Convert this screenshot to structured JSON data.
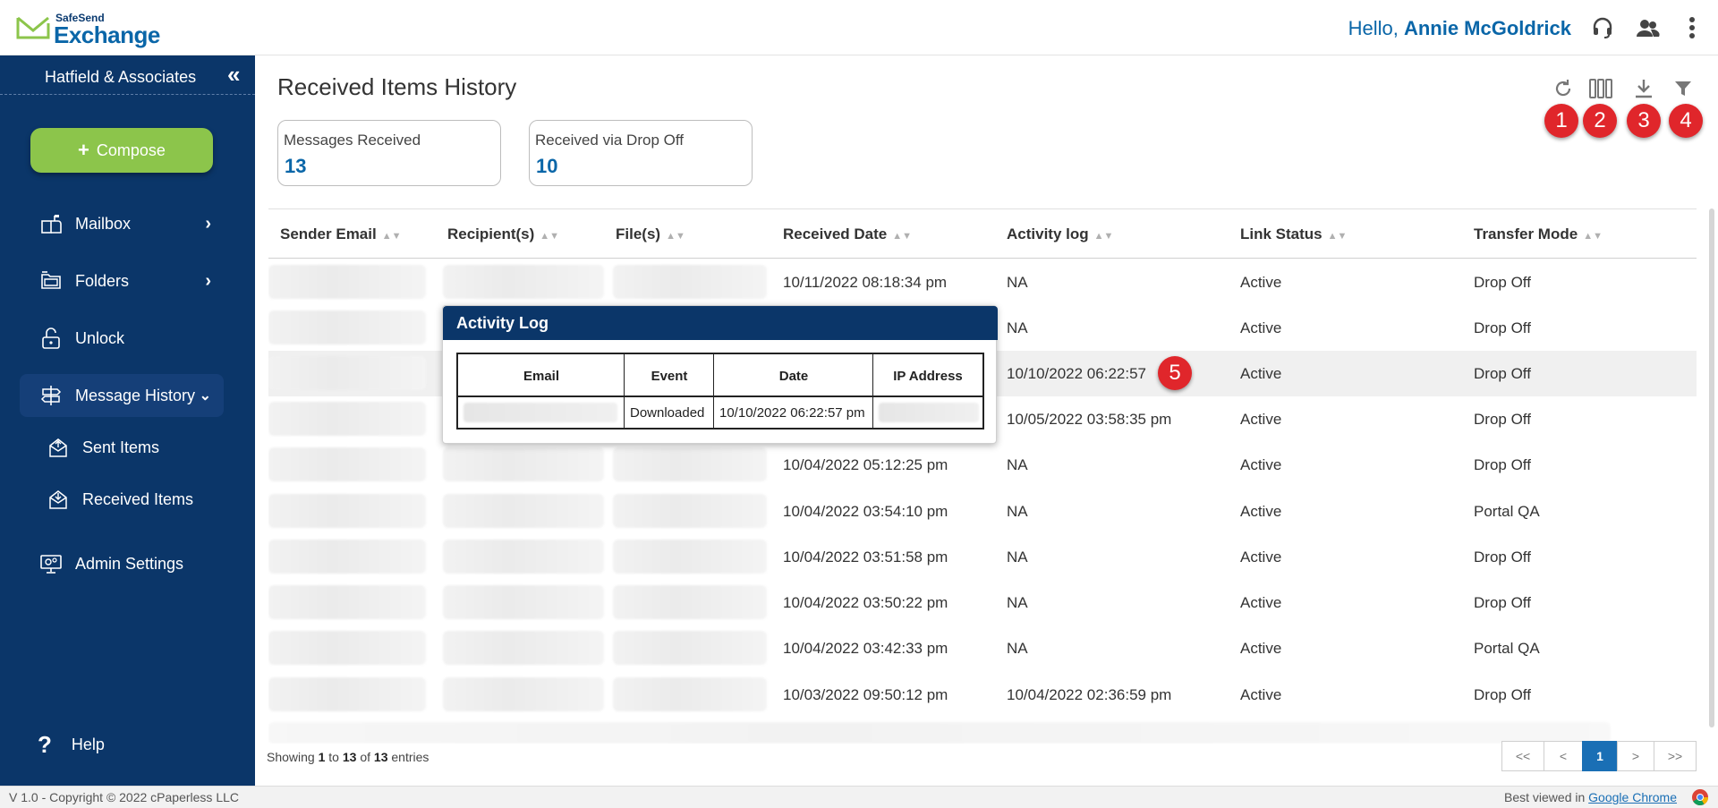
{
  "header": {
    "brand_small": "SafeSend",
    "brand_big": "Exchange",
    "greeting_prefix": "Hello, ",
    "user_name": "Annie McGoldrick",
    "icons": [
      "headset-icon",
      "users-icon",
      "kebab-menu-icon"
    ]
  },
  "sidebar": {
    "firm_name": "Hatfield & Associates",
    "collapse_glyph": "«",
    "compose_label": "Compose",
    "items": [
      {
        "label": "Mailbox",
        "icon": "mailbox-icon",
        "has_chevron": true
      },
      {
        "label": "Folders",
        "icon": "folders-icon",
        "has_chevron": true
      },
      {
        "label": "Unlock",
        "icon": "unlock-icon",
        "has_chevron": false
      },
      {
        "label": "Message History",
        "icon": "message-history-icon",
        "expanded": true
      },
      {
        "label": "Admin Settings",
        "icon": "admin-settings-icon",
        "has_chevron": false
      }
    ],
    "sub_items": [
      {
        "label": "Sent Items",
        "icon": "sent-items-icon"
      },
      {
        "label": "Received Items",
        "icon": "received-items-icon"
      }
    ],
    "help_label": "Help"
  },
  "main": {
    "title": "Received Items History",
    "toolbar": [
      "refresh-icon",
      "columns-icon",
      "download-icon",
      "filter-icon"
    ],
    "markers": [
      "1",
      "2",
      "3",
      "4",
      "5"
    ],
    "stats": [
      {
        "label": "Messages Received",
        "value": "13"
      },
      {
        "label": "Received via Drop Off",
        "value": "10"
      }
    ],
    "columns": [
      "Sender Email",
      "Recipient(s)",
      "File(s)",
      "Received Date",
      "Activity log",
      "Link Status",
      "Transfer Mode"
    ],
    "rows": [
      {
        "received_date": "10/11/2022 08:18:34 pm",
        "activity_log": "NA",
        "link_status": "Active",
        "transfer_mode": "Drop Off"
      },
      {
        "received_date": "",
        "activity_log": "NA",
        "link_status": "Active",
        "transfer_mode": "Drop Off"
      },
      {
        "received_date": "",
        "activity_log": "10/10/2022 06:22:57",
        "link_status": "Active",
        "transfer_mode": "Drop Off"
      },
      {
        "received_date": "",
        "activity_log": "10/05/2022 03:58:35 pm",
        "link_status": "Active",
        "transfer_mode": "Drop Off"
      },
      {
        "received_date": "10/04/2022 05:12:25 pm",
        "activity_log": "NA",
        "link_status": "Active",
        "transfer_mode": "Drop Off"
      },
      {
        "received_date": "10/04/2022 03:54:10 pm",
        "activity_log": "NA",
        "link_status": "Active",
        "transfer_mode": "Portal QA"
      },
      {
        "received_date": "10/04/2022 03:51:58 pm",
        "activity_log": "NA",
        "link_status": "Active",
        "transfer_mode": "Drop Off"
      },
      {
        "received_date": "10/04/2022 03:50:22 pm",
        "activity_log": "NA",
        "link_status": "Active",
        "transfer_mode": "Drop Off"
      },
      {
        "received_date": "10/04/2022 03:42:33 pm",
        "activity_log": "NA",
        "link_status": "Active",
        "transfer_mode": "Portal QA"
      },
      {
        "received_date": "10/03/2022 09:50:12 pm",
        "activity_log": "10/04/2022 02:36:59 pm",
        "link_status": "Active",
        "transfer_mode": "Drop Off"
      }
    ],
    "popover": {
      "title": "Activity Log",
      "headers": [
        "Email",
        "Event",
        "Date",
        "IP Address"
      ],
      "row": {
        "event": "Downloaded",
        "date": "10/10/2022 06:22:57 pm"
      }
    },
    "pagination": {
      "showing_prefix": "Showing ",
      "from": "1",
      "to_word": " to ",
      "to": "13",
      "of_word": " of ",
      "total": "13",
      "suffix": " entries",
      "buttons": [
        "<<",
        "<",
        "1",
        ">",
        ">>"
      ]
    }
  },
  "footer": {
    "copyright": "V 1.0 - Copyright © 2022  cPaperless LLC",
    "best_viewed": "Best viewed in ",
    "browser": "Google Chrome"
  },
  "colors": {
    "sidebar_bg": "#0b3669",
    "accent_blue": "#0a66a8",
    "compose_green": "#8cc54b",
    "marker_red": "#e0262b"
  }
}
